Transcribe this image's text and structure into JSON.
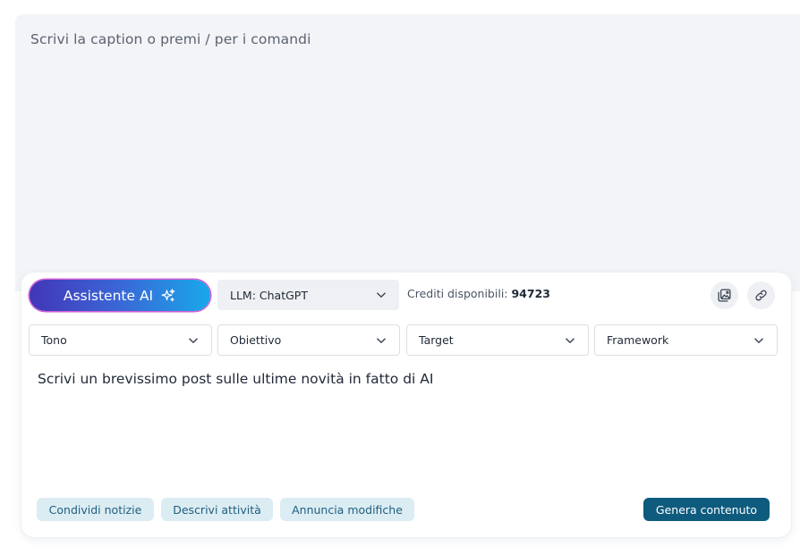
{
  "caption": {
    "placeholder": "Scrivi la caption o premi / per i comandi"
  },
  "assistant": {
    "button_label": "Assistente AI",
    "button_icon": "sparkles-icon",
    "llm_select": {
      "value": "LLM: ChatGPT",
      "icon": "chevron-down-icon"
    },
    "credits": {
      "label": "Crediti disponibili:",
      "value": "94723"
    },
    "actions": [
      {
        "name": "image-library-icon"
      },
      {
        "name": "link-icon"
      }
    ],
    "dropdowns": [
      {
        "label": "Tono"
      },
      {
        "label": "Obiettivo"
      },
      {
        "label": "Target"
      },
      {
        "label": "Framework"
      }
    ],
    "prompt": "Scrivi un brevissimo post sulle ultime novità in fatto di AI",
    "chips": [
      {
        "label": "Condividi notizie"
      },
      {
        "label": "Descrivi attività"
      },
      {
        "label": "Annuncia modifiche"
      }
    ],
    "generate_label": "Genera contenuto"
  },
  "colors": {
    "accent": "#0e5b7e",
    "chip_bg": "#dcecf3",
    "chip_text": "#1d5f7f",
    "gradient_start": "#4236b8",
    "gradient_end": "#19a8ea",
    "caption_bg": "#f2f4f7"
  }
}
